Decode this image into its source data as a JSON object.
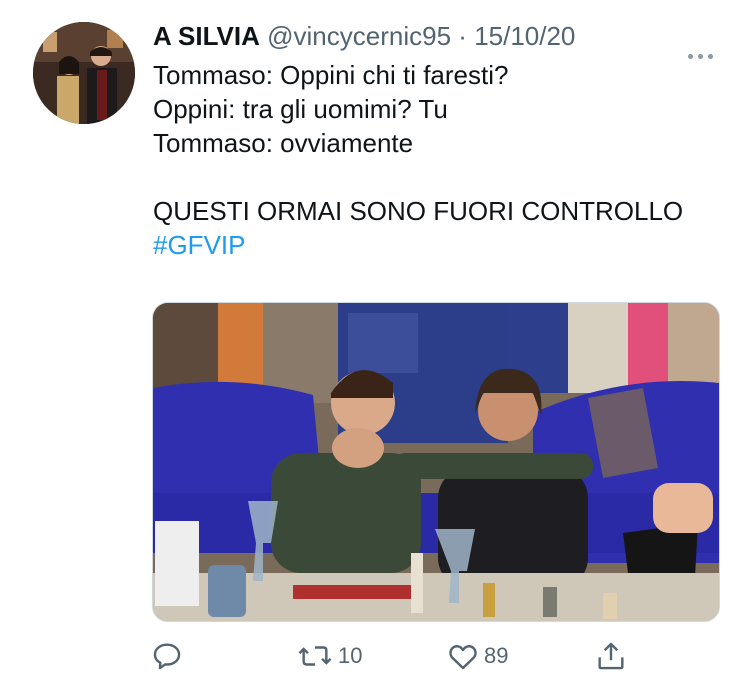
{
  "tweet": {
    "display_name": "A SILVIA",
    "handle": "@vincycernic95",
    "separator": "·",
    "date": "15/10/20",
    "lines": [
      "Tommaso: Oppini chi ti faresti?",
      "Oppini: tra gli uomimi? Tu",
      "Tommaso: ovviamente"
    ],
    "final_text": "QUESTI ORMAI SONO FUORI CONTROLLO",
    "hashtag": "#GFVIP"
  },
  "actions": {
    "reply_count": "",
    "retweet_count": "10",
    "like_count": "89"
  },
  "icons": {
    "more": "more-horizontal-icon",
    "reply": "reply-icon",
    "retweet": "retweet-icon",
    "like": "heart-icon",
    "share": "share-icon"
  },
  "colors": {
    "hashtag": "#1d9bf0",
    "secondary_text": "#536471",
    "sofa": "#2f2fb0"
  }
}
